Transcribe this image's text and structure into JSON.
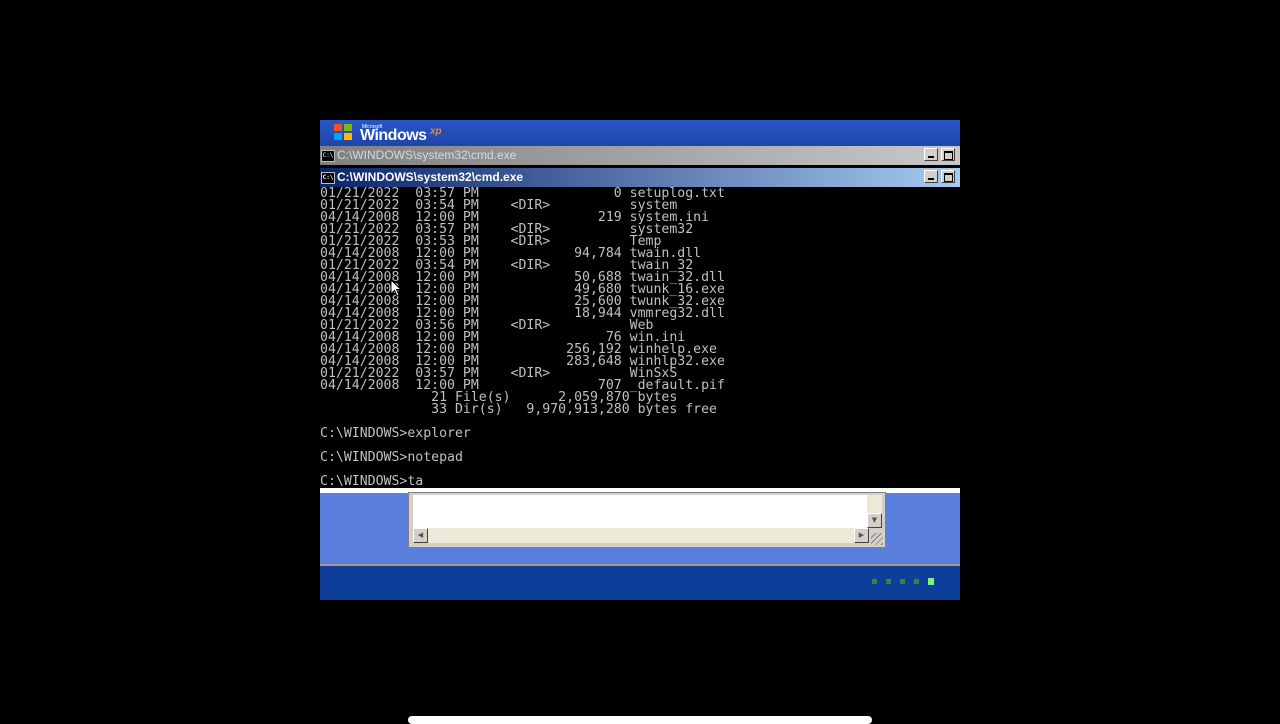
{
  "boot_screen": {
    "logo": {
      "microsoft": "Microsoft",
      "windows": "Windows",
      "xp": "xp"
    }
  },
  "windows": [
    {
      "title": "C:\\WINDOWS\\system32\\cmd.exe",
      "state": "inactive"
    },
    {
      "title": "C:\\WINDOWS\\system32\\cmd.exe",
      "state": "active"
    }
  ],
  "icons": {
    "window_icon": "cmd-icon",
    "minimize": "minimize-icon",
    "maximize": "maximize-icon",
    "cursor": "mouse-pointer-icon"
  },
  "console": {
    "lines": [
      "01/21/2022  03:57 PM                 0 setuplog.txt",
      "01/21/2022  03:54 PM    <DIR>          system",
      "04/14/2008  12:00 PM               219 system.ini",
      "01/21/2022  03:57 PM    <DIR>          system32",
      "01/21/2022  03:53 PM    <DIR>          Temp",
      "04/14/2008  12:00 PM            94,784 twain.dll",
      "01/21/2022  03:54 PM    <DIR>          twain_32",
      "04/14/2008  12:00 PM            50,688 twain_32.dll",
      "04/14/2008  12:00 PM            49,680 twunk_16.exe",
      "04/14/2008  12:00 PM            25,600 twunk_32.exe",
      "04/14/2008  12:00 PM            18,944 vmmreg32.dll",
      "01/21/2022  03:56 PM    <DIR>          Web",
      "04/14/2008  12:00 PM                76 win.ini",
      "04/14/2008  12:00 PM           256,192 winhelp.exe",
      "04/14/2008  12:00 PM           283,648 winhlp32.exe",
      "01/21/2022  03:57 PM    <DIR>          WinSxS",
      "04/14/2008  12:00 PM               707 _default.pif",
      "              21 File(s)      2,059,870 bytes",
      "              33 Dir(s)   9,970,913,280 bytes free",
      "",
      "C:\\WINDOWS>explorer",
      "",
      "C:\\WINDOWS>notepad",
      "",
      "C:\\WINDOWS>ta"
    ]
  },
  "colors": {
    "console_text": "#c0c0c0",
    "active_title": "#0a246a",
    "desktop_blue": "#5a7edc",
    "progress_active": "#7ef27a"
  }
}
